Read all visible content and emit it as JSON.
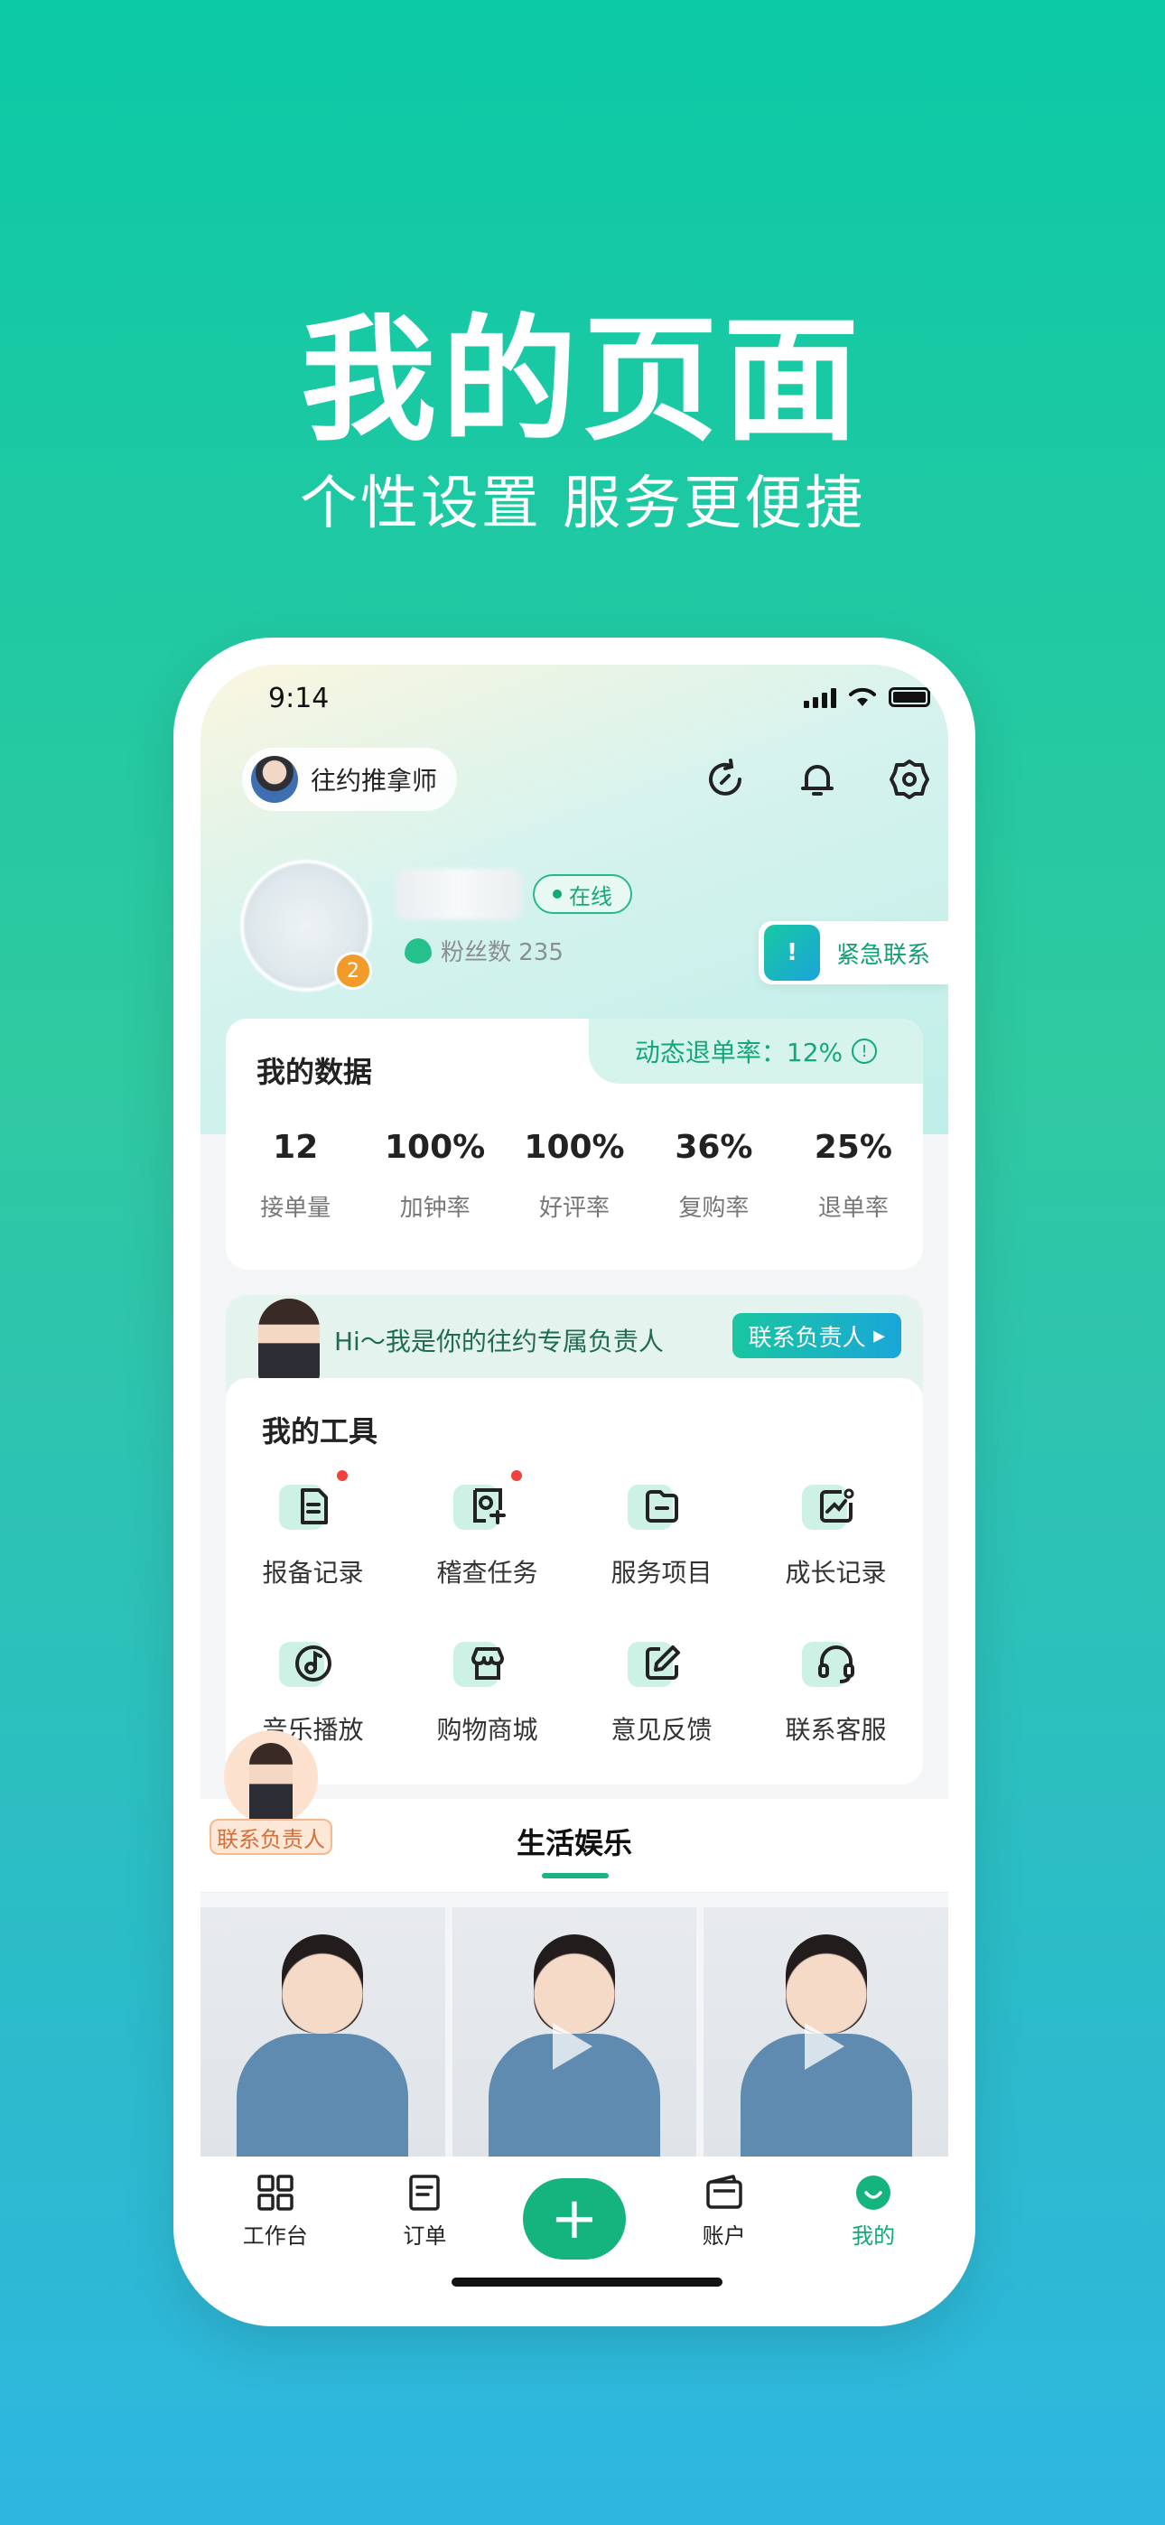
{
  "hero": {
    "title": "我的页面",
    "subtitle": "个性设置 服务更便捷"
  },
  "status": {
    "time": "9:14"
  },
  "header": {
    "role_label": "往约推拿师"
  },
  "profile": {
    "badge_number": "2",
    "online_label": "在线",
    "fans_label": "粉丝数 235",
    "emergency_label": "紧急联系"
  },
  "my_data": {
    "title": "我的数据",
    "refund_rate_label": "动态退单率：12%",
    "stats": [
      {
        "value": "12",
        "label": "接单量"
      },
      {
        "value": "100%",
        "label": "加钟率"
      },
      {
        "value": "100%",
        "label": "好评率"
      },
      {
        "value": "36%",
        "label": "复购率"
      },
      {
        "value": "25%",
        "label": "退单率"
      }
    ]
  },
  "manager": {
    "greeting": "Hi～我是你的往约专属负责人",
    "contact_button": "联系负责人",
    "float_label": "联系负责人"
  },
  "tools": {
    "title": "我的工具",
    "items": [
      {
        "label": "报备记录",
        "icon": "report-icon",
        "dot": true
      },
      {
        "label": "稽查任务",
        "icon": "inspect-icon",
        "dot": true
      },
      {
        "label": "服务项目",
        "icon": "service-icon",
        "dot": false
      },
      {
        "label": "成长记录",
        "icon": "growth-icon",
        "dot": false
      },
      {
        "label": "音乐播放",
        "icon": "music-icon",
        "dot": false
      },
      {
        "label": "购物商城",
        "icon": "shop-icon",
        "dot": false
      },
      {
        "label": "意见反馈",
        "icon": "feedback-icon",
        "dot": false
      },
      {
        "label": "联系客服",
        "icon": "headset-icon",
        "dot": false
      }
    ]
  },
  "life": {
    "tab_label": "生活娱乐"
  },
  "tabbar": {
    "items": [
      {
        "label": "工作台",
        "icon": "grid-icon"
      },
      {
        "label": "订单",
        "icon": "order-icon"
      },
      {
        "label": "",
        "icon": "plus-icon"
      },
      {
        "label": "账户",
        "icon": "wallet-icon"
      },
      {
        "label": "我的",
        "icon": "smile-icon"
      }
    ]
  },
  "colors": {
    "accent": "#13a877",
    "background_top": "#0cc9a6",
    "background_bottom": "#2fb6e0"
  }
}
